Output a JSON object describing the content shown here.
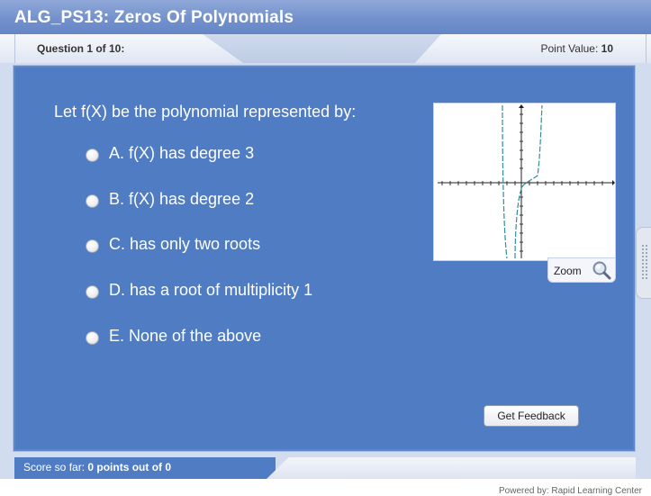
{
  "header": {
    "title": "ALG_PS13: Zeros Of Polynomials"
  },
  "question_bar": {
    "question_label": "Question 1 of 10:",
    "point_value_label": "Point Value:",
    "point_value": "10"
  },
  "question": {
    "prompt": "Let f(X) be the polynomial represented by:",
    "options": [
      {
        "label": "A. f(X) has degree 3"
      },
      {
        "label": "B. f(X) has degree 2"
      },
      {
        "label": "C. has only two roots"
      },
      {
        "label": "D. has a root of multiplicity 1"
      },
      {
        "label": "E. None of the above"
      }
    ]
  },
  "graph": {
    "zoom_label": "Zoom",
    "icon": "magnifier-icon"
  },
  "actions": {
    "feedback_label": "Get Feedback"
  },
  "footer": {
    "score_label": "Score so far:",
    "score_value": "0 points out of 0",
    "powered_by": "Powered by: Rapid Learning Center"
  },
  "colors": {
    "panel": "#4f7cc3",
    "title_bar": "#7391cd",
    "curve": "#2f8f9a"
  }
}
